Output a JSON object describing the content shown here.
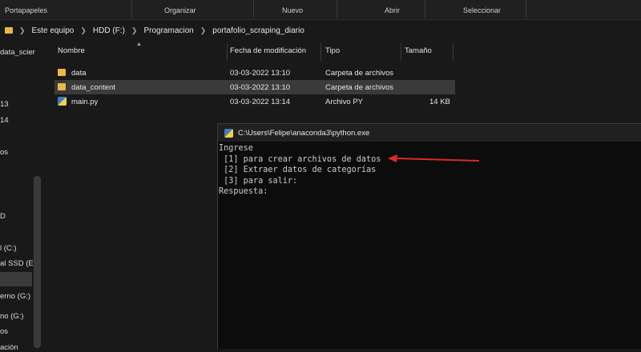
{
  "ribbon": {
    "groups": [
      "Portapapeles",
      "Organizar",
      "Nuevo",
      "Abrir",
      "Seleccionar"
    ]
  },
  "address": {
    "crumbs": [
      "Este equipo",
      "HDD (F:)",
      "Programacion",
      "portafolio_scraping_diario"
    ]
  },
  "nav": {
    "items": [
      "data_scier",
      "13",
      "14",
      "os",
      "D",
      "l (C:)",
      "al SSD (E:)",
      "erno (G:)",
      "no (G:)",
      "os",
      "ación"
    ]
  },
  "columns": {
    "name": "Nombre",
    "modified": "Fecha de modificación",
    "type": "Tipo",
    "size": "Tamaño"
  },
  "files": [
    {
      "name": "data",
      "modified": "03-03-2022 13:10",
      "type": "Carpeta de archivos",
      "size": "",
      "icon": "folder-icon"
    },
    {
      "name": "data_content",
      "modified": "03-03-2022 13:10",
      "type": "Carpeta de archivos",
      "size": "",
      "icon": "folder-icon"
    },
    {
      "name": "main.py",
      "modified": "03-03-2022 13:14",
      "type": "Archivo PY",
      "size": "14 KB",
      "icon": "python-file-icon"
    }
  ],
  "console": {
    "title": "C:\\Users\\Felipe\\anaconda3\\python.exe",
    "lines": [
      "Ingrese",
      " [1] para crear archivos de datos",
      " [2] Extraer datos de categorías",
      " [3] para salir:",
      "Respuesta:"
    ]
  },
  "colors": {
    "folder": "#e8b84a",
    "annotation_arrow": "#d92a2a",
    "console_bg": "#0c0c0c"
  }
}
